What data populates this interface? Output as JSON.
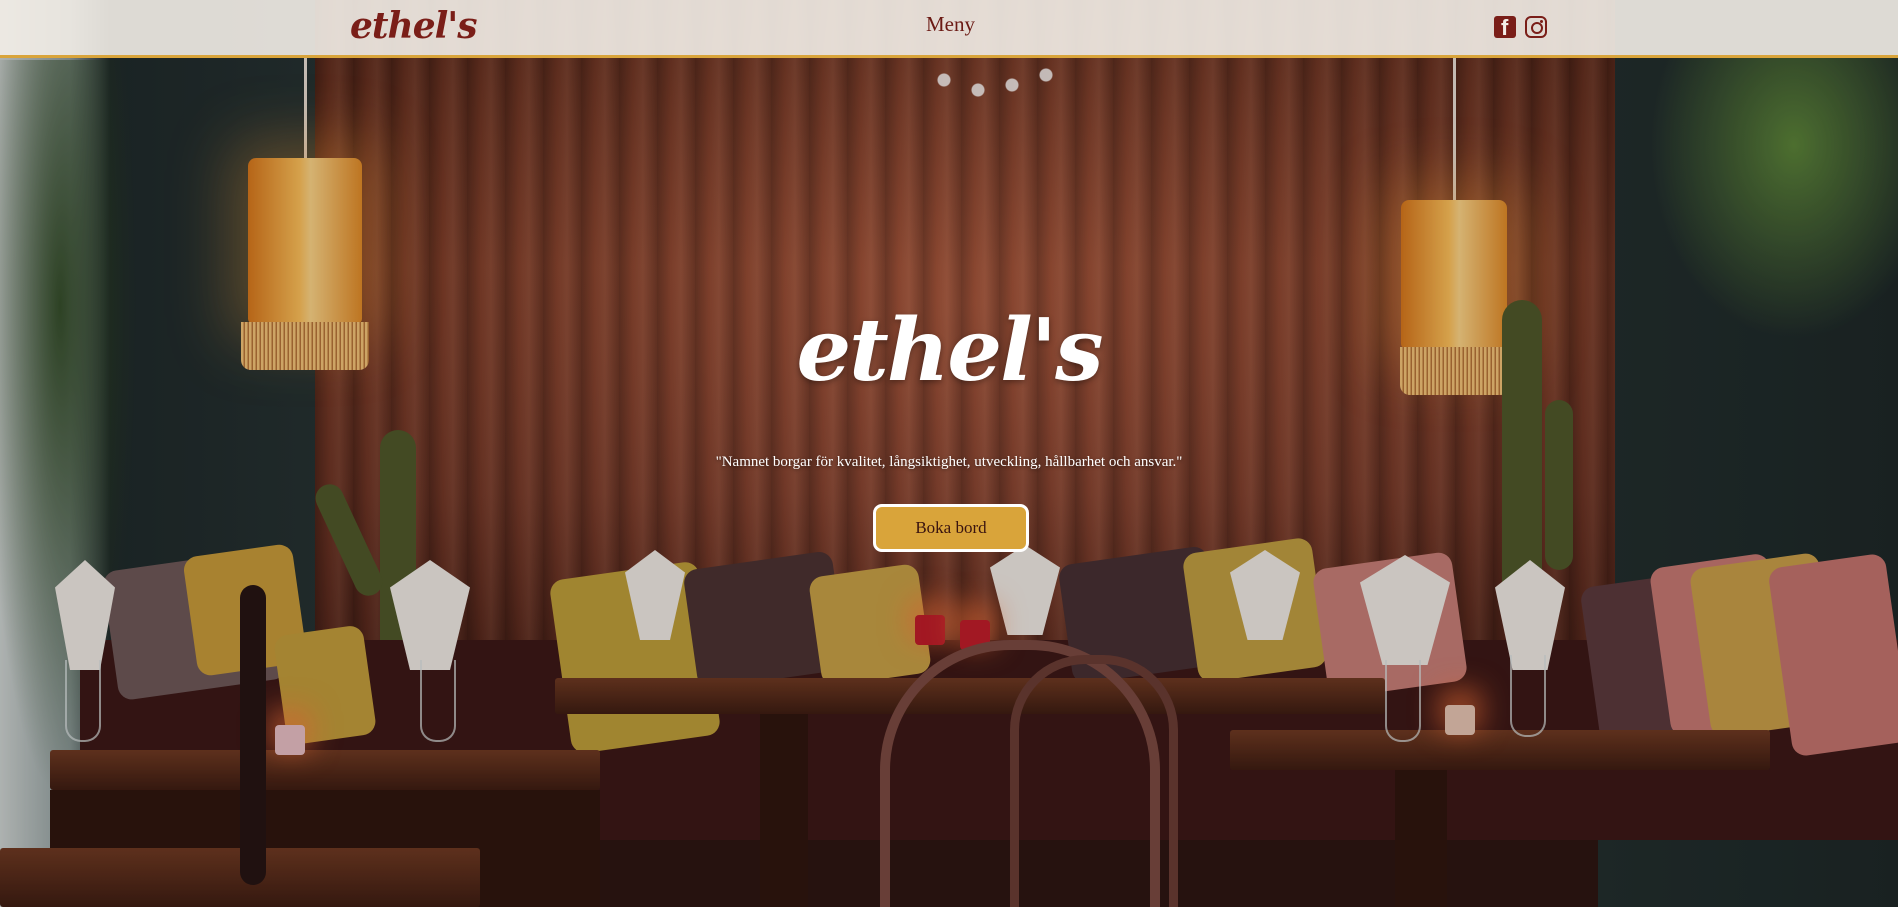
{
  "header": {
    "logo_text": "ethel's",
    "nav": {
      "menu_label": "Meny"
    },
    "social": {
      "facebook_icon": "facebook-icon",
      "instagram_icon": "instagram-icon"
    }
  },
  "hero": {
    "title": "ethel's",
    "tagline": "\"Namnet borgar för kvalitet, långsiktighet, utveckling, hållbarhet och ansvar.\"",
    "cta_label": "Boka bord"
  },
  "colors": {
    "brand_dark_red": "#7a1e18",
    "accent_gold": "#d9a43a",
    "header_bg": "#f3eee8",
    "white": "#ffffff"
  }
}
